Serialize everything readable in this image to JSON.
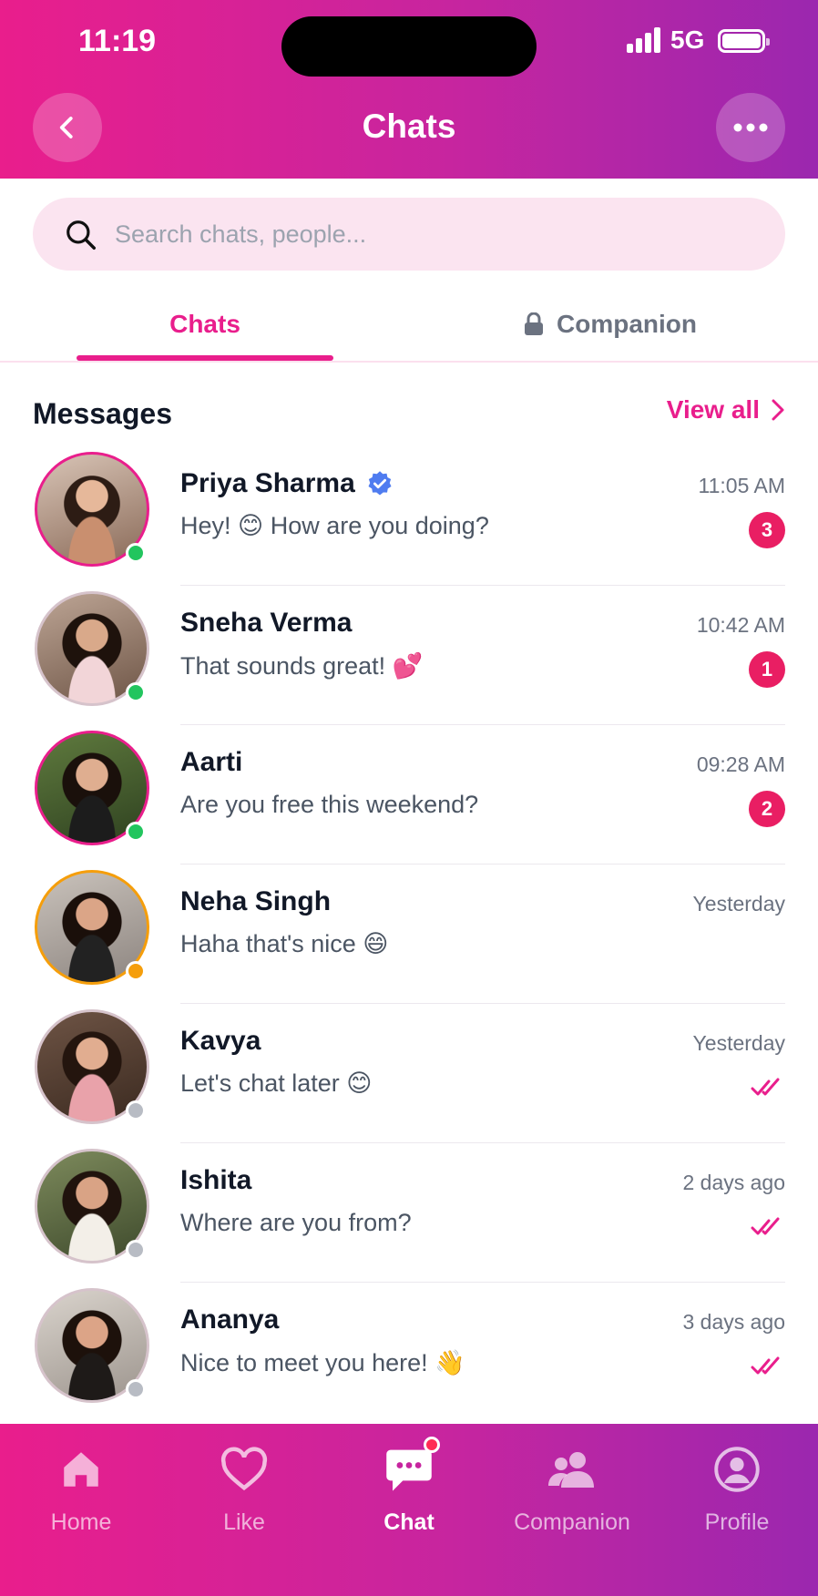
{
  "status_bar": {
    "time": "11:19",
    "network": "5G"
  },
  "header": {
    "title": "Chats"
  },
  "search": {
    "placeholder": "Search chats, people..."
  },
  "tabs": [
    {
      "label": "Chats",
      "active": true
    },
    {
      "label": "Companion",
      "icon": "lock-icon",
      "active": false
    }
  ],
  "messages_section": {
    "title": "Messages",
    "view_all": "View all"
  },
  "chats": [
    {
      "name": "Priya Sharma",
      "verified": true,
      "message": "Hey! ",
      "emoji": "😊",
      "message_after": " How are you doing?",
      "time": "11:05 AM",
      "unread": "3",
      "presence": "online"
    },
    {
      "name": "Sneha Verma",
      "verified": false,
      "message": "That sounds great! ",
      "emoji": "💕",
      "message_after": "",
      "time": "10:42 AM",
      "unread": "1",
      "presence": "online"
    },
    {
      "name": "Aarti",
      "verified": false,
      "message": "Are you free this weekend?",
      "emoji": "",
      "message_after": "",
      "time": "09:28 AM",
      "unread": "2",
      "presence": "online"
    },
    {
      "name": "Neha Singh",
      "verified": false,
      "message": "Haha that's nice ",
      "emoji": "😄",
      "message_after": "",
      "time": "Yesterday",
      "unread": "",
      "presence": "away"
    },
    {
      "name": "Kavya",
      "verified": false,
      "message": "Let's chat later ",
      "emoji": "😊",
      "message_after": "",
      "time": "Yesterday",
      "read": true,
      "presence": "offline"
    },
    {
      "name": "Ishita",
      "verified": false,
      "message": "Where are you from?",
      "emoji": "",
      "message_after": "",
      "time": "2 days ago",
      "read": true,
      "presence": "offline"
    },
    {
      "name": "Ananya",
      "verified": false,
      "message": "Nice to meet you here! ",
      "emoji": "👋",
      "message_after": "",
      "time": "3 days ago",
      "read": true,
      "presence": "offline"
    }
  ],
  "bottom_nav": [
    {
      "label": "Home",
      "icon": "home-icon",
      "active": false
    },
    {
      "label": "Like",
      "icon": "heart-icon",
      "active": false
    },
    {
      "label": "Chat",
      "icon": "chat-icon",
      "active": true,
      "notification_dot": true
    },
    {
      "label": "Companion",
      "icon": "people-icon",
      "active": false
    },
    {
      "label": "Profile",
      "icon": "profile-icon",
      "active": false
    }
  ],
  "colors": {
    "accent": "#e91e8c",
    "gradient_end": "#9b27af",
    "online": "#22c55e",
    "away": "#f59e0b",
    "offline": "#b8bcc4",
    "unread_badge": "#e91e63"
  }
}
